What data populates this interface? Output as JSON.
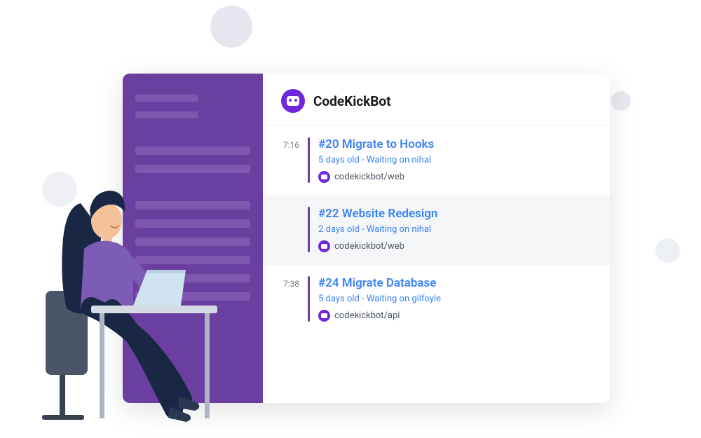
{
  "header": {
    "bot_name": "CodeKickBot"
  },
  "items": [
    {
      "time": "7:16",
      "title": "#20 Migrate to Hooks",
      "meta": "5 days old - Waiting on nihal",
      "repo": "codekickbot/web",
      "highlighted": false
    },
    {
      "time": "",
      "title": "#22 Website Redesign",
      "meta": "2 days old - Waiting on nihal",
      "repo": "codekickbot/web",
      "highlighted": true
    },
    {
      "time": "7:38",
      "title": "#24 Migrate Database",
      "meta": "5 days old - Waiting on gilfoyle",
      "repo": "codekickbot/api",
      "highlighted": false
    }
  ]
}
